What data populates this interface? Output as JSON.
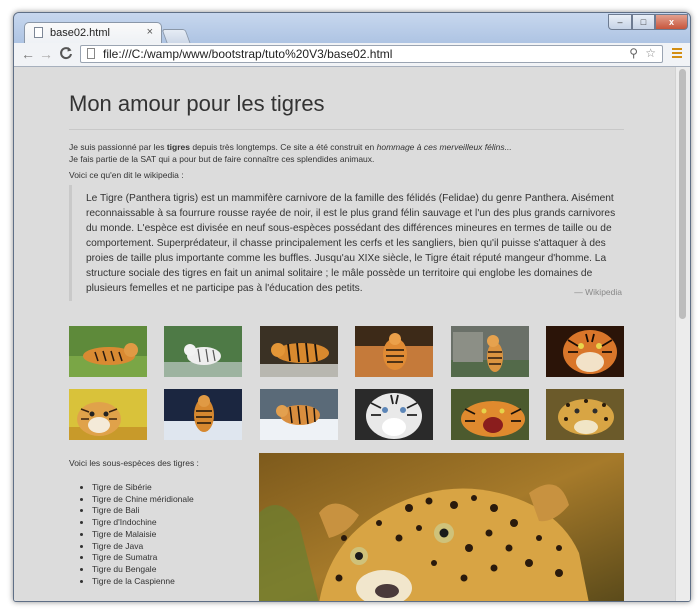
{
  "browser": {
    "tab_title": "base02.html",
    "tab_close": "×",
    "url": "file:///C:/wamp/www/bootstrap/tuto%20V3/base02.html",
    "window_controls": {
      "minimize": "–",
      "maximize": "□",
      "close": "x"
    },
    "nav": {
      "back": "←",
      "forward": "→",
      "reload": "C"
    },
    "zoom_glyph": "⚲",
    "star_glyph": "☆"
  },
  "page": {
    "title": "Mon amour pour les tigres",
    "intro": {
      "part1": "Je suis passionné par les ",
      "bold": "tigres",
      "part2": " depuis très longtemps. Ce site a été construit en ",
      "italic": "hommage à ces merveilleux félins...",
      "line2": "Je fais partie de la SAT qui a pour but de faire connaître ces splendides animaux."
    },
    "wiki_intro": "Voici ce qu'en dit le wikipedia :",
    "quote": {
      "text": "Le Tigre (Panthera tigris) est un mammifère carnivore de la famille des félidés (Felidae) du genre Panthera. Aisément reconnaissable à sa fourrure rousse rayée de noir, il est le plus grand félin sauvage et l'un des plus grands carnivores du monde. L'espèce est divisée en neuf sous-espèces possédant des différences mineures en termes de taille ou de comportement. Superprédateur, il chasse principalement les cerfs et les sangliers, bien qu'il puisse s'attaquer à des proies de taille plus importante comme les buffles. Jusqu'au XIXe siècle, le Tigre était réputé mangeur d'homme. La structure sociale des tigres en fait un animal solitaire ; le mâle possède un territoire qui englobe les domaines de plusieurs femelles et ne participe pas à l'éducation des petits.",
      "source": "— Wikipedia"
    },
    "subspecies_intro": "Voici les sous-espèces des tigres :",
    "subspecies": [
      "Tigre de Sibérie",
      "Tigre de Chine méridionale",
      "Tigre de Bali",
      "Tigre d'Indochine",
      "Tigre de Malaisie",
      "Tigre de Java",
      "Tigre de Sumatra",
      "Tigre du Bengale",
      "Tigre de la Caspienne"
    ]
  },
  "colors": {
    "page_bg": "#dcdcdc",
    "text": "#333333",
    "menu_accent": "#d38e12"
  }
}
